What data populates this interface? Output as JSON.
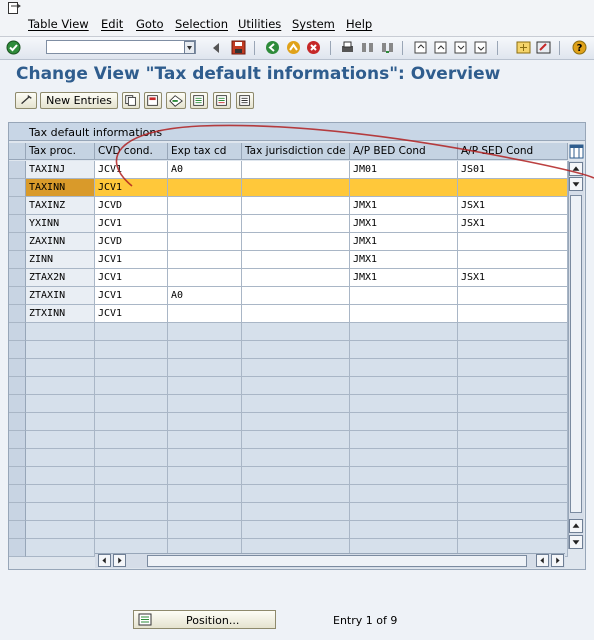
{
  "menu": {
    "items": [
      "Table View",
      "Edit",
      "Goto",
      "Selection",
      "Utilities",
      "System",
      "Help"
    ]
  },
  "toolbar": {
    "command_field_value": "",
    "icons": [
      "enter-icon",
      "back-icon",
      "save-icon",
      "back-nav-icon",
      "exit-icon",
      "cancel-icon",
      "print-icon",
      "find-icon",
      "find-next-icon",
      "first-page-icon",
      "previous-page-icon",
      "next-page-icon",
      "last-page-icon",
      "create-session-icon",
      "shortcut-icon",
      "help-icon"
    ]
  },
  "page": {
    "title": "Change View \"Tax default informations\": Overview"
  },
  "app_toolbar": {
    "new_entries_label": "New Entries",
    "icons": [
      "display-change-icon",
      "copy-icon",
      "delete-icon",
      "undo-icon",
      "select-all-icon",
      "select-block-icon",
      "deselect-all-icon"
    ]
  },
  "table": {
    "title": "Tax default informations",
    "columns": [
      "Tax proc.",
      "CVD cond.",
      "Exp tax cd",
      "Tax jurisdiction cde",
      "A/P BED Cond",
      "A/P SED Cond"
    ],
    "rows": [
      [
        "TAXINJ",
        "JCV1",
        "A0",
        "",
        "JM01",
        "JS01"
      ],
      [
        "TAXINN",
        "JCV1",
        "",
        "",
        "",
        ""
      ],
      [
        "TAXINZ",
        "JCVD",
        "",
        "",
        "JMX1",
        "JSX1"
      ],
      [
        "YXINN",
        "JCV1",
        "",
        "",
        "JMX1",
        "JSX1"
      ],
      [
        "ZAXINN",
        "JCVD",
        "",
        "",
        "JMX1",
        ""
      ],
      [
        "ZINN",
        "JCV1",
        "",
        "",
        "JMX1",
        ""
      ],
      [
        "ZTAX2N",
        "JCV1",
        "",
        "",
        "JMX1",
        "JSX1"
      ],
      [
        "ZTAXIN",
        "JCV1",
        "A0",
        "",
        "",
        ""
      ],
      [
        "ZTXINN",
        "JCV1",
        "",
        "",
        "",
        ""
      ]
    ],
    "highlighted_row": 1,
    "empty_rows": 13
  },
  "footer": {
    "position_label": "Position...",
    "entry_text": "Entry 1 of 9"
  },
  "colors": {
    "title": "#2f5d8e",
    "highlight": "#ffc83a",
    "annotation": "#b02020"
  }
}
